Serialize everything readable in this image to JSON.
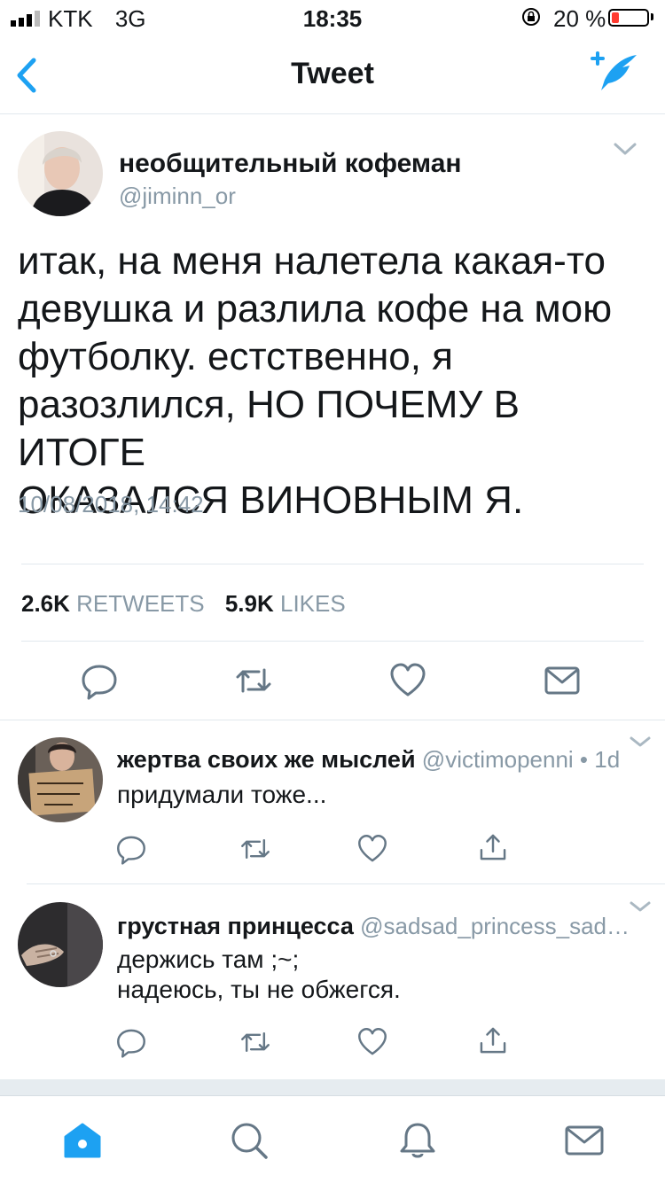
{
  "status_bar": {
    "carrier": "KTK",
    "network": "3G",
    "time": "18:35",
    "battery_percent": "20 %",
    "battery_level": 0.2,
    "battery_color": "#ff3b30"
  },
  "nav": {
    "title": "Tweet",
    "back_icon": "chevron-left-icon",
    "compose_icon": "compose-feather-icon",
    "accent": "#1da1f2"
  },
  "tweet": {
    "display_name": "необщительный кофеман",
    "handle": "@jiminn_or",
    "text_lines": [
      "итак, на меня налетела какая-то",
      "девушка и разлила кофе на мою",
      "футболку. естственно, я",
      "разозлился, НО ПОЧЕМУ В ИТОГЕ",
      "ОКАЗАЛСЯ ВИНОВНЫМ Я."
    ],
    "date": "10/08/2018, 14:42",
    "retweets_count": "2.6K",
    "retweets_label": "RETWEETS",
    "likes_count": "5.9K",
    "likes_label": "LIKES"
  },
  "replies": [
    {
      "display_name": "жертва своих же мыслей",
      "meta": "@victimopenni • 1d",
      "lines": [
        "придумали тоже..."
      ]
    },
    {
      "display_name": "грустная принцесса",
      "meta": "@sadsad_princess_sad…",
      "lines": [
        "держись там ;~;",
        "надеюсь, ты не обжегся."
      ]
    }
  ],
  "tabs": [
    "home-icon",
    "search-icon",
    "notifications-icon",
    "messages-icon"
  ]
}
